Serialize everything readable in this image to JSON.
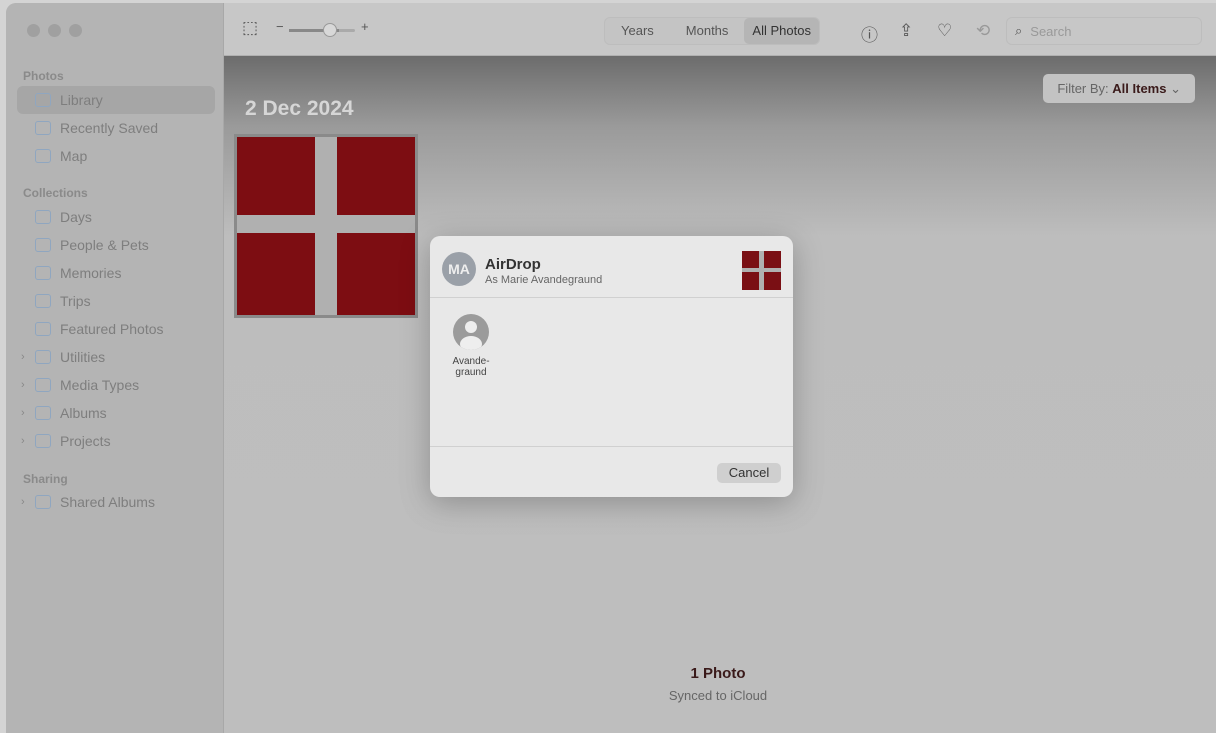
{
  "sidebar": {
    "sections": [
      "Photos",
      "Collections",
      "Sharing"
    ],
    "items": [
      {
        "label": "Library",
        "selected": true
      },
      {
        "label": "Recently Saved"
      },
      {
        "label": "Map"
      },
      {
        "label": "Days"
      },
      {
        "label": "People & Pets"
      },
      {
        "label": "Memories"
      },
      {
        "label": "Trips"
      },
      {
        "label": "Featured Photos"
      },
      {
        "label": "Utilities",
        "expandable": true
      },
      {
        "label": "Media Types",
        "expandable": true
      },
      {
        "label": "Albums",
        "expandable": true
      },
      {
        "label": "Projects",
        "expandable": true
      },
      {
        "label": "Shared Albums",
        "expandable": true
      }
    ]
  },
  "toolbar": {
    "zoom_minus": "−",
    "zoom_plus": "+",
    "zoom_level": 0.75,
    "tabs": [
      "Years",
      "Months",
      "All Photos"
    ],
    "active_tab": "All Photos",
    "search_placeholder": "Search"
  },
  "content": {
    "date": "2 Dec 2024",
    "filter_label": "Filter By:",
    "filter_value": "All Items",
    "count": "1 Photo",
    "sync": "Synced to iCloud"
  },
  "airdrop": {
    "avatar_initials": "MA",
    "title": "AirDrop",
    "subtitle": "As Marie Avandegraund",
    "peer_line1": "Avande-",
    "peer_line2": "graund",
    "cancel": "Cancel"
  }
}
